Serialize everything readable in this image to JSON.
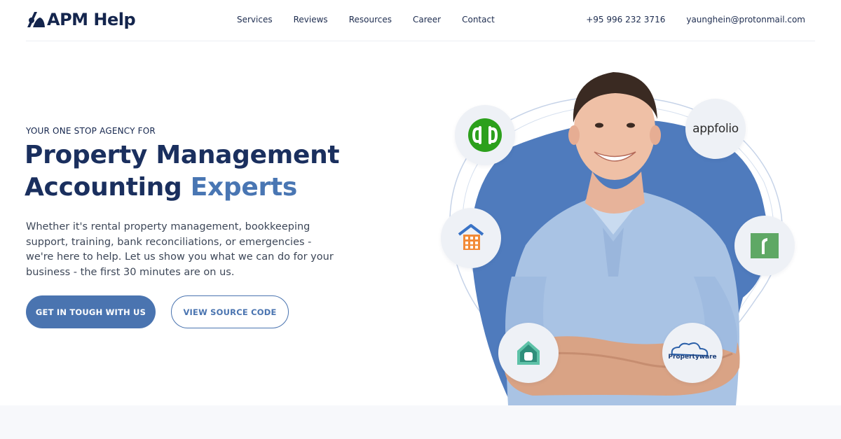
{
  "brand": {
    "name": "APM Help"
  },
  "nav": {
    "items": [
      "Services",
      "Reviews",
      "Resources",
      "Career",
      "Contact"
    ]
  },
  "contact": {
    "phone": "+95 996 232 3716",
    "email": "yaunghein@protonmail.com"
  },
  "hero": {
    "eyebrow": "YOUR ONE STOP AGENCY FOR",
    "headline_line1": "Property Management",
    "headline_line2": "Accounting",
    "headline_accent": "Experts",
    "lead": "Whether it's rental property management, bookkeeping support, training, bank reconciliations, or emergencies - we're here to help. Let us show you what we can do for your business - the first 30 minutes are on us.",
    "primary_button": "GET IN TOUGH WITH US",
    "secondary_button": "VIEW SOURCE CODE"
  },
  "badges": {
    "appfolio": "appfolio",
    "propertyware": "Propertyware"
  },
  "colors": {
    "navy": "#1a2f5e",
    "accent_blue": "#4976b3",
    "blob_blue": "#4f7bbd",
    "badge_bg": "#eef1f6",
    "quickbooks_green": "#2ca01c"
  }
}
